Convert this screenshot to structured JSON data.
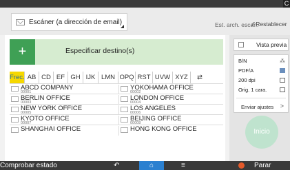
{
  "header": {
    "destination_select": "Escáner (a dirección de email)",
    "stored_files_label": "Est. arch. escan.",
    "reset_label": "Restablecer",
    "corner_letter": "C"
  },
  "specify": {
    "plus": "+",
    "label": "Especificar destino(s)"
  },
  "tabs": [
    "Frec.",
    "AB",
    "CD",
    "EF",
    "GH",
    "IJK",
    "LMN",
    "OPQ",
    "RST",
    "UVW",
    "XYZ",
    "⇄"
  ],
  "active_tab": "Frec.",
  "address_rows": [
    {
      "left": {
        "name": "ABCD COMPANY",
        "num": "00001"
      },
      "right": {
        "name": "YOKOHAMA OFFICE",
        "num": "00002"
      }
    },
    {
      "left": {
        "name": "BERLIN OFFICE",
        "num": "00003"
      },
      "right": {
        "name": "LONDON OFFICE",
        "num": "00004"
      }
    },
    {
      "left": {
        "name": "NEW YORK OFFICE",
        "num": "00005"
      },
      "right": {
        "name": "LOS ANGELES",
        "num": "00006"
      }
    },
    {
      "left": {
        "name": "KYOTO OFFICE",
        "num": "00007"
      },
      "right": {
        "name": "BEIJING OFFICE",
        "num": "00008"
      }
    },
    {
      "left": {
        "name": "SHANGHAI OFFICE",
        "num": ""
      },
      "right": {
        "name": "HONG KONG OFFICE",
        "num": ""
      }
    }
  ],
  "side": {
    "preview_label": "Vista previa",
    "settings": [
      "B/N",
      "PDF/A",
      "200 dpi",
      "Orig. 1 cara."
    ],
    "send_settings_label": "Enviar ajustes",
    "start_label": "Inicio"
  },
  "footer": {
    "check_status": "Comprobar estado",
    "back_icon": "↶",
    "home_icon": "⌂",
    "menu_icon": "≡",
    "stop_label": "Parar"
  },
  "colors": {
    "accent_green": "#3fa055",
    "tab_active": "#f6d800",
    "home_blue": "#2b80d0",
    "stop_orange": "#e55a2a"
  }
}
